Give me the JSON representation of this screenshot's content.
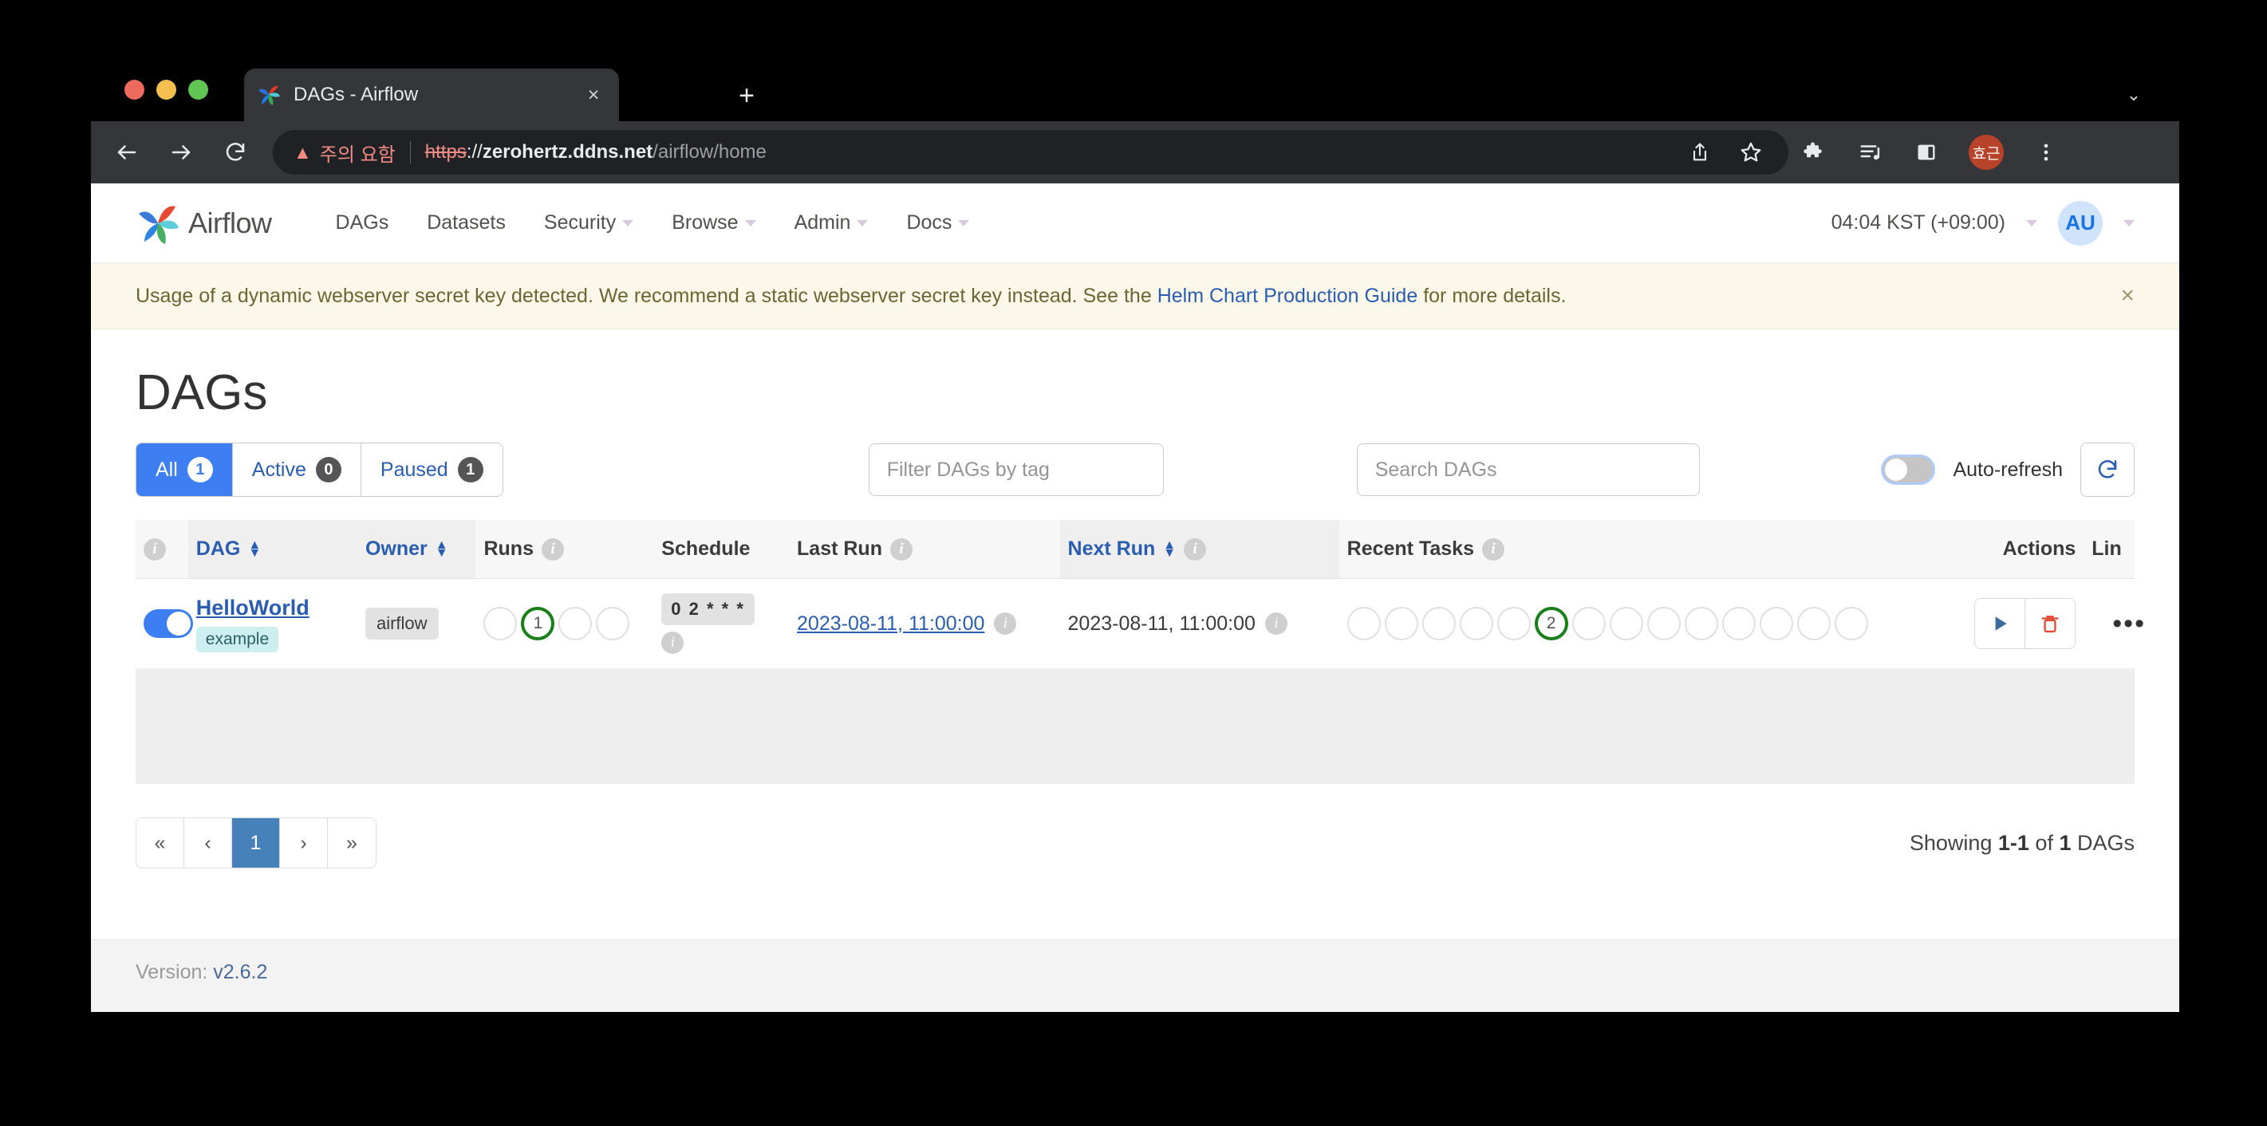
{
  "browser": {
    "tab": {
      "title": "DAGs - Airflow",
      "favicon": "airflow-pinwheel-icon",
      "close": "×"
    },
    "new_tab": "+",
    "tabstrip_caret": "⌄",
    "omnibox": {
      "warning_label": "주의 요함",
      "scheme": "https",
      "scheme_sep": "://",
      "host": "zerohertz.ddns.net",
      "path": "/airflow/home"
    },
    "profile_initials": "효근"
  },
  "airflow": {
    "brand": "Airflow",
    "nav_links": [
      {
        "label": "DAGs",
        "has_caret": false
      },
      {
        "label": "Datasets",
        "has_caret": false
      },
      {
        "label": "Security",
        "has_caret": true
      },
      {
        "label": "Browse",
        "has_caret": true
      },
      {
        "label": "Admin",
        "has_caret": true
      },
      {
        "label": "Docs",
        "has_caret": true
      }
    ],
    "clock": "04:04 KST (+09:00)",
    "user_initials": "AU",
    "alert": {
      "text_before": "Usage of a dynamic webserver secret key detected. We recommend a static webserver secret key instead. See the ",
      "link": "Helm Chart Production Guide",
      "text_after": " for more details.",
      "close": "×"
    },
    "page_title": "DAGs",
    "filters": [
      {
        "label": "All",
        "count": "1",
        "active": true
      },
      {
        "label": "Active",
        "count": "0",
        "active": false
      },
      {
        "label": "Paused",
        "count": "1",
        "active": false
      }
    ],
    "tag_filter_placeholder": "Filter DAGs by tag",
    "search_placeholder": "Search DAGs",
    "auto_refresh_label": "Auto-refresh",
    "table_headers": [
      {
        "label": "",
        "info": true,
        "sortable": false
      },
      {
        "label": "DAG",
        "info": false,
        "sortable": true
      },
      {
        "label": "Owner",
        "info": false,
        "sortable": true
      },
      {
        "label": "Runs",
        "info": true,
        "sortable": false
      },
      {
        "label": "Schedule",
        "info": false,
        "sortable": false
      },
      {
        "label": "Last Run",
        "info": true,
        "sortable": false
      },
      {
        "label": "Next Run",
        "info": true,
        "sortable": true
      },
      {
        "label": "Recent Tasks",
        "info": true,
        "sortable": false
      },
      {
        "label": "Actions",
        "info": false,
        "sortable": false
      },
      {
        "label": "Lin",
        "info": false,
        "sortable": false
      }
    ],
    "row": {
      "paused_toggle_state": "on",
      "dag_id": "HelloWorld",
      "tag": "example",
      "owner": "airflow",
      "runs": [
        {
          "value": "",
          "state": "none"
        },
        {
          "value": "1",
          "state": "success"
        },
        {
          "value": "",
          "state": "none"
        },
        {
          "value": "",
          "state": "none"
        }
      ],
      "schedule": "0 2 * * *",
      "last_run": "2023-08-11, 11:00:00",
      "next_run": "2023-08-11, 11:00:00",
      "recent_tasks": [
        {
          "value": "",
          "state": "none"
        },
        {
          "value": "",
          "state": "none"
        },
        {
          "value": "",
          "state": "none"
        },
        {
          "value": "",
          "state": "none"
        },
        {
          "value": "",
          "state": "none"
        },
        {
          "value": "2",
          "state": "success"
        },
        {
          "value": "",
          "state": "none"
        },
        {
          "value": "",
          "state": "none"
        },
        {
          "value": "",
          "state": "none"
        },
        {
          "value": "",
          "state": "none"
        },
        {
          "value": "",
          "state": "none"
        },
        {
          "value": "",
          "state": "none"
        },
        {
          "value": "",
          "state": "none"
        },
        {
          "value": "",
          "state": "none"
        }
      ],
      "links_dots": "•••"
    },
    "pagination": [
      {
        "label": "«",
        "active": false
      },
      {
        "label": "‹",
        "active": false
      },
      {
        "label": "1",
        "active": true
      },
      {
        "label": "›",
        "active": false
      },
      {
        "label": "»",
        "active": false
      }
    ],
    "showing": {
      "prefix": "Showing ",
      "range": "1-1",
      "middle": " of ",
      "total": "1",
      "suffix": " DAGs"
    },
    "footer": {
      "label": "Version: ",
      "version": "v2.6.2"
    }
  },
  "colors": {
    "accent_blue": "#3d7ff2",
    "link_blue": "#2a5db0",
    "success_green": "#1a7f1a",
    "danger_red": "#e04a32",
    "alert_bg": "#fbf8e9"
  }
}
